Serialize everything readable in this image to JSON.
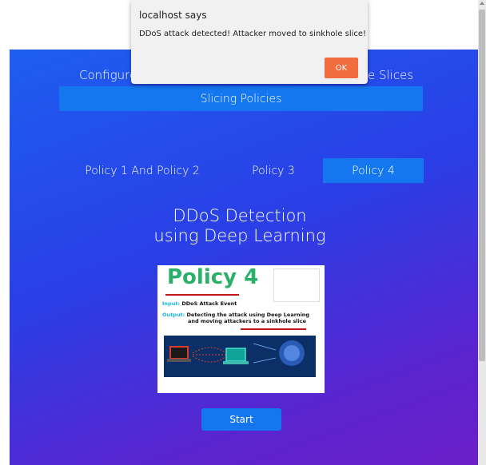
{
  "nav": {
    "configure_label": "Configure",
    "slices_label": "e Slices",
    "slicing_policies_label": "Slicing Policies"
  },
  "tabs": [
    {
      "label": "Policy 1 And Policy 2",
      "active": false
    },
    {
      "label": "Policy 3",
      "active": false
    },
    {
      "label": "Policy 4",
      "active": true
    }
  ],
  "heading": {
    "line1": "DDoS Detection",
    "line2": "using Deep Learning"
  },
  "card": {
    "title": "Policy 4",
    "input_key": "Input:",
    "input_value": "DDoS Attack Event",
    "output_key": "Output:",
    "output_line1": "Detecting the attack using Deep Learning",
    "output_line2": "and moving attackers to a sinkhole slice"
  },
  "start_label": "Start",
  "dialog": {
    "title": "localhost says",
    "message": "DDoS attack detected! Attacker moved to sinkhole slice!",
    "ok_label": "OK"
  },
  "colors": {
    "accent": "#1477f0",
    "ok_button": "#f26d3d",
    "policy_title": "#2ab068",
    "underline": "#c0161c"
  }
}
